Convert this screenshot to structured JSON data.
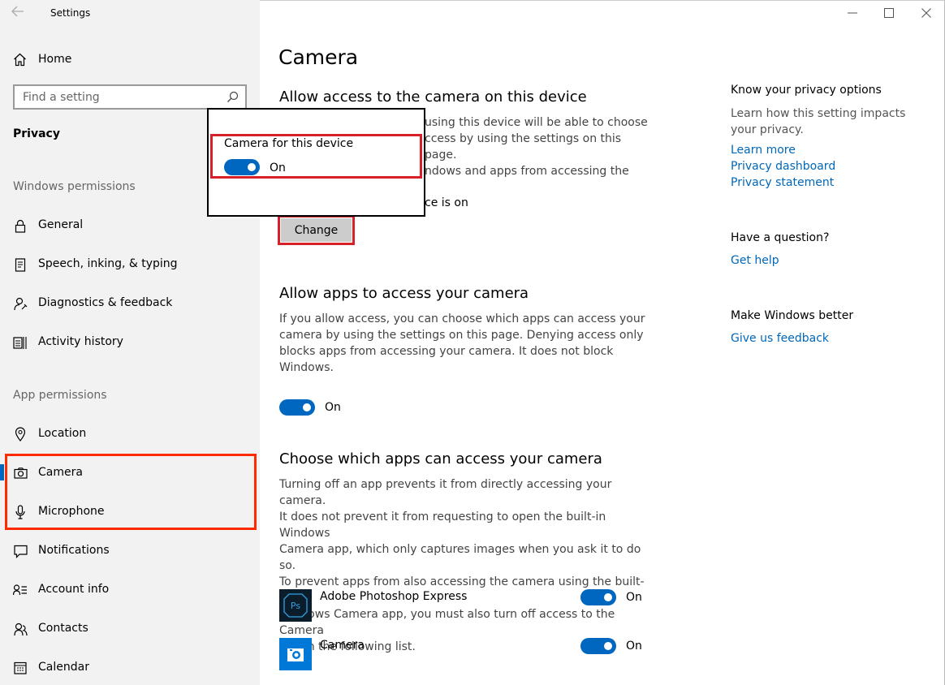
{
  "window": {
    "title": "Settings"
  },
  "sidebar": {
    "home": "Home",
    "search_placeholder": "Find a setting",
    "section": "Privacy",
    "windows_permissions_label": "Windows permissions",
    "app_permissions_label": "App permissions",
    "windows_items": [
      {
        "label": "General",
        "icon": "lock-icon"
      },
      {
        "label": "Speech, inking, & typing",
        "icon": "speech-icon"
      },
      {
        "label": "Diagnostics & feedback",
        "icon": "diagnostics-icon"
      },
      {
        "label": "Activity history",
        "icon": "activity-icon"
      }
    ],
    "app_items": [
      {
        "label": "Location",
        "icon": "location-icon"
      },
      {
        "label": "Camera",
        "icon": "camera-icon",
        "selected": true
      },
      {
        "label": "Microphone",
        "icon": "microphone-icon"
      },
      {
        "label": "Notifications",
        "icon": "notifications-icon"
      },
      {
        "label": "Account info",
        "icon": "account-info-icon"
      },
      {
        "label": "Contacts",
        "icon": "contacts-icon"
      },
      {
        "label": "Calendar",
        "icon": "calendar-icon"
      }
    ]
  },
  "main": {
    "title": "Camera",
    "device_section": {
      "heading": "Allow access to the camera on this device",
      "lines": [
        "using this device will be able to choose",
        "ccess by using the settings on this page.",
        "ndows and apps from accessing the"
      ],
      "status_fragment": "ce is on",
      "change_button": "Change"
    },
    "popup": {
      "label": "Camera for this device",
      "toggle_state": "On"
    },
    "apps_section": {
      "heading": "Allow apps to access your camera",
      "lines": [
        "If you allow access, you can choose which apps can access your",
        "camera by using the settings on this page. Denying access only",
        "blocks apps from accessing your camera. It does not block",
        "Windows."
      ],
      "toggle_state": "On"
    },
    "choose_section": {
      "heading": "Choose which apps can access your camera",
      "lines": [
        "Turning off an app prevents it from directly accessing your camera.",
        "It does not prevent it from requesting to open the built-in Windows",
        "Camera app, which only captures images when you ask it to do so.",
        "To prevent apps from also accessing the camera using the built-in",
        "Windows Camera app, you must also turn off access to the Camera",
        "app in the following list."
      ],
      "apps": [
        {
          "name": "Adobe Photoshop Express",
          "state": "On",
          "icon": "photoshop-express-icon"
        },
        {
          "name": "Camera",
          "state": "On",
          "icon": "camera-app-icon"
        }
      ]
    }
  },
  "right": {
    "privacy_title": "Know your privacy options",
    "privacy_text": "Learn how this setting impacts your privacy.",
    "links": [
      "Learn more",
      "Privacy dashboard",
      "Privacy statement"
    ],
    "question_title": "Have a question?",
    "help_link": "Get help",
    "better_title": "Make Windows better",
    "feedback_link": "Give us feedback"
  },
  "colors": {
    "accent": "#0067c0",
    "link": "#0067b8",
    "highlight_red": "#d6202a",
    "sidebar_bg": "#f2f2f2"
  }
}
